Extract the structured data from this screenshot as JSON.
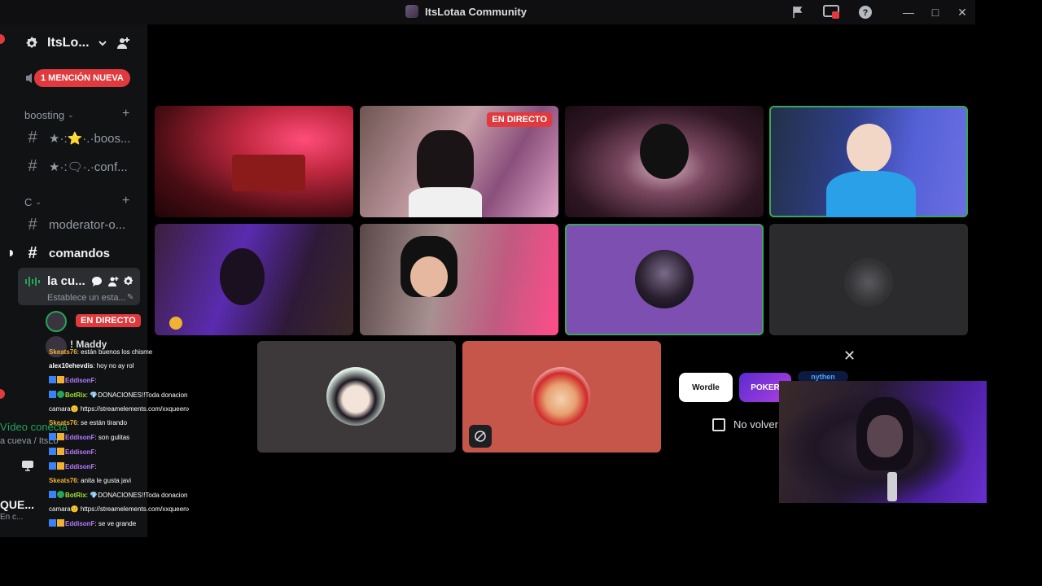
{
  "window": {
    "title": "ItsLotaa Community"
  },
  "sidebar": {
    "server_name": "ItsLo...",
    "mention_pill": "1 MENCIÓN NUEVA",
    "categories": [
      {
        "label": "boosting"
      },
      {
        "label": "C"
      }
    ],
    "channels": [
      {
        "label": "★·:⭐·.·boos..."
      },
      {
        "label": "★·:🗨·.·conf..."
      },
      {
        "label": "moderator-o..."
      },
      {
        "label": "comandos"
      }
    ],
    "voice_channel": {
      "name": "la cu...",
      "status": "Establece un esta..."
    },
    "live_badge": "EN DIRECTO",
    "member_name": "! Maddy"
  },
  "chat_overlay": {
    "messages": [
      {
        "user": "Skeats76",
        "text": ": están buenos los chisme",
        "color": "#f0b232"
      },
      {
        "user": "alex10ehevdis",
        "text": ": hoy no ay rol",
        "color": "#ffffff"
      },
      {
        "user": "EddisonF",
        "text": ":",
        "color": "#b57cff"
      },
      {
        "user": "BotRix",
        "text": ": 💎DONACIONES!!Toda donacion e",
        "color": "#a3e635"
      },
      {
        "user": "",
        "text": "camara🙂 https://streamelements.com/xxqueenx",
        "color": "#ffffff"
      },
      {
        "user": "Skeats76",
        "text": ": se están tirando",
        "color": "#f0b232"
      },
      {
        "user": "EddisonF",
        "text": ": son gulitas",
        "color": "#b57cff"
      },
      {
        "user": "EddisonF",
        "text": ":",
        "color": "#b57cff"
      },
      {
        "user": "EddisonF",
        "text": ":",
        "color": "#b57cff"
      },
      {
        "user": "Skeats76",
        "text": ": anita le gusta javi",
        "color": "#f0b232"
      },
      {
        "user": "BotRix",
        "text": ": 💎DONACIONES!!Toda donacion e",
        "color": "#a3e635"
      },
      {
        "user": "",
        "text": "camara🙂 https://streamelements.com/xxqueenx",
        "color": "#ffffff"
      },
      {
        "user": "EddisonF",
        "text": ": se ve grande",
        "color": "#b57cff"
      }
    ],
    "behind_texts": {
      "video_connected": "Vídeo conecta",
      "channel_path": "a cueva / ItsLo",
      "user_short": "QUE...",
      "user_status": "En c..."
    }
  },
  "stage": {
    "tiles": [
      {
        "name": "tile-1",
        "live": ""
      },
      {
        "name": "tile-2",
        "live": "EN DIRECTO"
      }
    ],
    "activities": {
      "wordle": "Wordle",
      "poker": "POKER",
      "third": "nythen"
    },
    "checkbox_label": "No volver"
  },
  "colors": {
    "accent_red": "#e03a3e",
    "speaking_green": "#3ba55d",
    "sidebar_bg": "#111214"
  }
}
